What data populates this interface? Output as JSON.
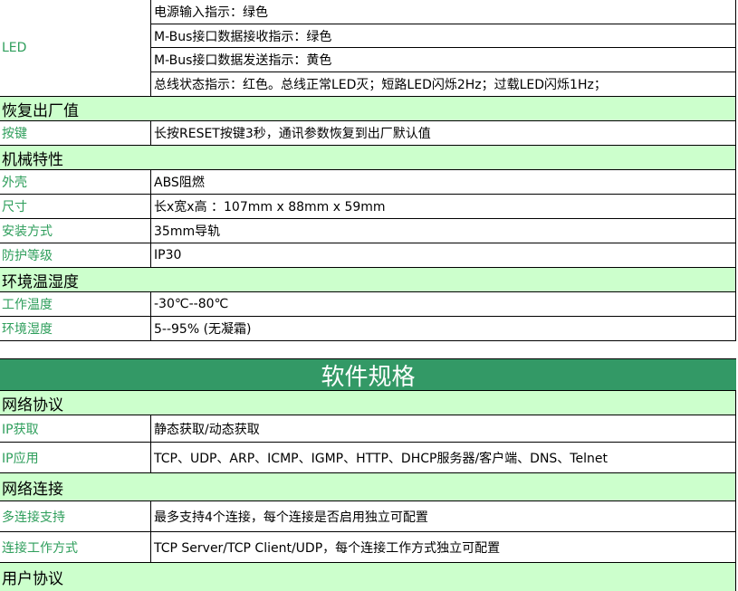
{
  "led": {
    "label": "LED",
    "items": [
      "电源输入指示：绿色",
      "M-Bus接口数据接收指示：绿色",
      "M-Bus接口数据发送指示：黄色",
      "总线状态指示：红色。总线正常LED灭；短路LED闪烁2Hz；过载LED闪烁1Hz；"
    ]
  },
  "factory_reset": {
    "title": "恢复出厂值",
    "rows": [
      {
        "label": "按键",
        "value": "长按RESET按键3秒，通讯参数恢复到出厂默认值"
      }
    ]
  },
  "mechanical": {
    "title": "机械特性",
    "rows": [
      {
        "label": "外壳",
        "value": "ABS阻燃"
      },
      {
        "label": "尺寸",
        "value": "长x宽x高 ：107mm x 88mm x 59mm"
      },
      {
        "label": "安装方式",
        "value": "35mm导轨"
      },
      {
        "label": "防护等级",
        "value": "IP30"
      }
    ]
  },
  "environment": {
    "title": "环境温湿度",
    "rows": [
      {
        "label": "工作温度",
        "value": "-30℃--80℃"
      },
      {
        "label": "环境湿度",
        "value": "5--95% (无凝霜)"
      }
    ]
  },
  "software_spec": {
    "title": "软件规格"
  },
  "network_protocol": {
    "title": "网络协议",
    "rows": [
      {
        "label": "IP获取",
        "value": "静态获取/动态获取"
      },
      {
        "label": "IP应用",
        "value": "TCP、UDP、ARP、ICMP、IGMP、HTTP、DHCP服务器/客户端、DNS、Telnet"
      }
    ]
  },
  "network_connection": {
    "title": "网络连接",
    "rows": [
      {
        "label": "多连接支持",
        "value": "最多支持4个连接，每个连接是否启用独立可配置"
      },
      {
        "label": "连接工作方式",
        "value": "TCP Server/TCP Client/UDP，每个连接工作方式独立可配置"
      }
    ]
  },
  "user_protocol": {
    "title": "用户协议"
  }
}
